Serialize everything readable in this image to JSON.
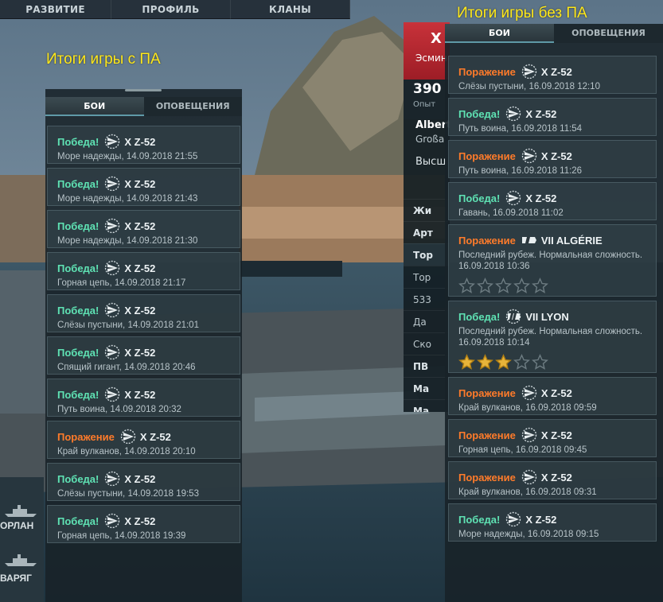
{
  "nav": [
    "РАЗВИТИЕ",
    "ПРОФИЛЬ",
    "КЛАНЫ"
  ],
  "captions": {
    "left": "Итоги игры с ПА",
    "right": "Итоги игры без ПА"
  },
  "ship_panel": {
    "ship_name": "X",
    "ship_type": "Эсмин",
    "xp": "390",
    "xp_label": "Опыт",
    "commander": "Albert",
    "commander_sub": "Großa",
    "rank": "Высш",
    "sections": [
      "Жи",
      "Арт",
      "Тор",
      "Тор",
      "533",
      "Да",
      "Ско",
      "ПВ",
      "Ма",
      "Ма"
    ]
  },
  "left_panel": {
    "tabs": [
      "БОИ",
      "ОПОВЕЩЕНИЯ"
    ],
    "entries": [
      {
        "result": "Победа!",
        "kind": "win",
        "ship": "X Z-52",
        "detail": "Море надежды, 14.09.2018 21:55"
      },
      {
        "result": "Победа!",
        "kind": "win",
        "ship": "X Z-52",
        "detail": "Море надежды, 14.09.2018 21:43"
      },
      {
        "result": "Победа!",
        "kind": "win",
        "ship": "X Z-52",
        "detail": "Море надежды, 14.09.2018 21:30"
      },
      {
        "result": "Победа!",
        "kind": "win",
        "ship": "X Z-52",
        "detail": "Горная цепь, 14.09.2018 21:17"
      },
      {
        "result": "Победа!",
        "kind": "win",
        "ship": "X Z-52",
        "detail": "Слёзы пустыни, 14.09.2018 21:01"
      },
      {
        "result": "Победа!",
        "kind": "win",
        "ship": "X Z-52",
        "detail": "Спящий гигант, 14.09.2018 20:46"
      },
      {
        "result": "Победа!",
        "kind": "win",
        "ship": "X Z-52",
        "detail": "Путь воина, 14.09.2018 20:32"
      },
      {
        "result": "Поражение",
        "kind": "loss",
        "ship": "X Z-52",
        "detail": "Край вулканов, 14.09.2018 20:10"
      },
      {
        "result": "Победа!",
        "kind": "win",
        "ship": "X Z-52",
        "detail": "Слёзы пустыни, 14.09.2018 19:53"
      },
      {
        "result": "Победа!",
        "kind": "win",
        "ship": "X Z-52",
        "detail": "Горная цепь, 14.09.2018 19:39"
      }
    ]
  },
  "right_panel": {
    "tabs": [
      "БОИ",
      "ОПОВЕЩЕНИЯ"
    ],
    "entries": [
      {
        "result": "Поражение",
        "kind": "loss",
        "ship": "X Z-52",
        "icon": "destroyer-icon",
        "detail": "Слёзы пустыни, 16.09.2018 12:10"
      },
      {
        "result": "Победа!",
        "kind": "win",
        "ship": "X Z-52",
        "icon": "destroyer-icon",
        "detail": "Путь воина, 16.09.2018 11:54"
      },
      {
        "result": "Поражение",
        "kind": "loss",
        "ship": "X Z-52",
        "icon": "destroyer-icon",
        "detail": "Путь воина, 16.09.2018 11:26"
      },
      {
        "result": "Победа!",
        "kind": "win",
        "ship": "X Z-52",
        "icon": "destroyer-icon",
        "detail": "Гавань, 16.09.2018 11:02"
      },
      {
        "result": "Поражение",
        "kind": "loss",
        "ship": "VII ALGÉRIE",
        "icon": "cruiser-icon",
        "detail": "Последний рубеж. Нормальная сложность.",
        "detail2": "16.09.2018 10:36",
        "stars": 0
      },
      {
        "result": "Победа!",
        "kind": "win",
        "ship": "VII LYON",
        "icon": "battleship-icon",
        "detail": "Последний рубеж. Нормальная сложность.",
        "detail2": "16.09.2018 10:14",
        "stars": 3
      },
      {
        "result": "Поражение",
        "kind": "loss",
        "ship": "X Z-52",
        "icon": "destroyer-icon",
        "detail": "Край вулканов, 16.09.2018 09:59"
      },
      {
        "result": "Поражение",
        "kind": "loss",
        "ship": "X Z-52",
        "icon": "destroyer-icon",
        "detail": "Горная цепь, 16.09.2018 09:45"
      },
      {
        "result": "Поражение",
        "kind": "loss",
        "ship": "X Z-52",
        "icon": "destroyer-icon",
        "detail": "Край вулканов, 16.09.2018 09:31"
      },
      {
        "result": "Победа!",
        "kind": "win",
        "ship": "X Z-52",
        "icon": "destroyer-icon",
        "detail": "Море надежды, 16.09.2018 09:15"
      }
    ]
  },
  "port_ships": [
    "ОРЛАН",
    "ВАРЯГ"
  ],
  "colors": {
    "win": "#5fe3b4",
    "loss": "#ff7b2a",
    "caption": "#ffe81a"
  }
}
